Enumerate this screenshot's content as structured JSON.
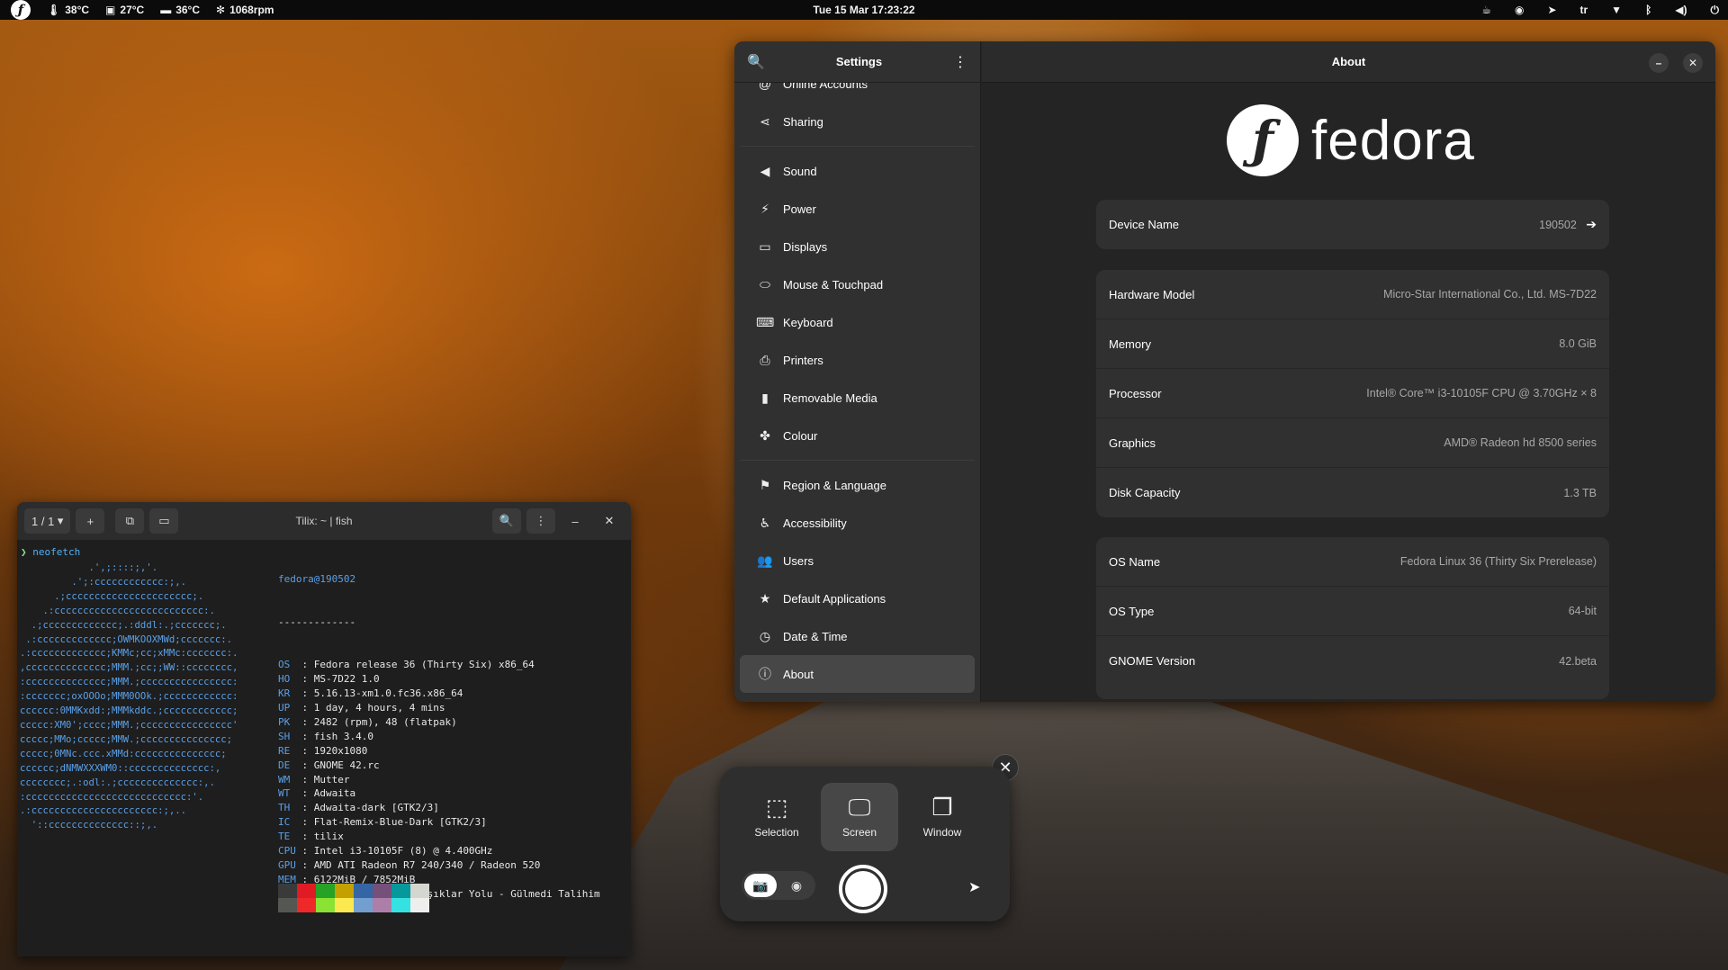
{
  "topbar": {
    "temp_cpu": "38°C",
    "temp_mb": "27°C",
    "temp_disk": "36°C",
    "fan": "1068rpm",
    "datetime": "Tue 15 Mar  17:23:22",
    "keyboard_layout": "tr"
  },
  "settings": {
    "title": "Settings",
    "content_title": "About",
    "sidebar": [
      {
        "label": "Online Accounts",
        "icon": "at-icon"
      },
      {
        "label": "Sharing",
        "icon": "share-icon"
      },
      {
        "label": "Sound",
        "icon": "speaker-icon"
      },
      {
        "label": "Power",
        "icon": "power-icon"
      },
      {
        "label": "Displays",
        "icon": "display-icon"
      },
      {
        "label": "Mouse & Touchpad",
        "icon": "mouse-icon"
      },
      {
        "label": "Keyboard",
        "icon": "keyboard-icon"
      },
      {
        "label": "Printers",
        "icon": "printer-icon"
      },
      {
        "label": "Removable Media",
        "icon": "usb-icon"
      },
      {
        "label": "Colour",
        "icon": "colour-icon"
      },
      {
        "label": "Region & Language",
        "icon": "flag-icon"
      },
      {
        "label": "Accessibility",
        "icon": "accessibility-icon"
      },
      {
        "label": "Users",
        "icon": "users-icon"
      },
      {
        "label": "Default Applications",
        "icon": "star-icon"
      },
      {
        "label": "Date & Time",
        "icon": "clock-icon"
      },
      {
        "label": "About",
        "icon": "info-icon"
      }
    ],
    "logo_text": "fedora",
    "device": {
      "label": "Device Name",
      "value": "190502"
    },
    "hardware": [
      {
        "label": "Hardware Model",
        "value": "Micro-Star International Co., Ltd. MS-7D22"
      },
      {
        "label": "Memory",
        "value": "8.0 GiB"
      },
      {
        "label": "Processor",
        "value": "Intel® Core™ i3-10105F CPU @ 3.70GHz × 8"
      },
      {
        "label": "Graphics",
        "value": "AMD® Radeon hd 8500 series"
      },
      {
        "label": "Disk Capacity",
        "value": "1.3 TB"
      }
    ],
    "os": [
      {
        "label": "OS Name",
        "value": "Fedora Linux 36 (Thirty Six Prerelease)"
      },
      {
        "label": "OS Type",
        "value": "64-bit"
      },
      {
        "label": "GNOME Version",
        "value": "42.beta"
      }
    ]
  },
  "terminal": {
    "tab_count": "1 / 1",
    "title": "Tilix: ~ | fish",
    "command": "neofetch",
    "user_host": "fedora@190502",
    "separator": "-------------",
    "info": [
      {
        "k": "OS",
        "v": "Fedora release 36 (Thirty Six) x86_64"
      },
      {
        "k": "HO",
        "v": "MS-7D22 1.0"
      },
      {
        "k": "KR",
        "v": "5.16.13-xm1.0.fc36.x86_64"
      },
      {
        "k": "UP",
        "v": "1 day, 4 hours, 4 mins"
      },
      {
        "k": "PK",
        "v": "2482 (rpm), 48 (flatpak)"
      },
      {
        "k": "SH",
        "v": "fish 3.4.0"
      },
      {
        "k": "RE",
        "v": "1920x1080"
      },
      {
        "k": "DE",
        "v": "GNOME 42.rc"
      },
      {
        "k": "WM",
        "v": "Mutter"
      },
      {
        "k": "WT",
        "v": "Adwaita"
      },
      {
        "k": "TH",
        "v": "Adwaita-dark [GTK2/3]"
      },
      {
        "k": "IC",
        "v": "Flat-Remix-Blue-Dark [GTK2/3]"
      },
      {
        "k": "TE",
        "v": "tilix"
      },
      {
        "k": "CPU",
        "v": "Intel i3-10105F (8) @ 4.400GHz"
      },
      {
        "k": "GPU",
        "v": "AMD ATI Radeon R7 240/340 / Radeon 520"
      },
      {
        "k": "MEM",
        "v": "6122MiB / 7852MiB"
      },
      {
        "k": "SNG",
        "v": "Murat Göğebakan - Aşıklar Yolu - Gülmedi Talihim"
      }
    ],
    "palette_top": [
      "#3a3a3a",
      "#e01b24",
      "#26a226",
      "#c4a000",
      "#3465a4",
      "#75507b",
      "#06989a",
      "#d3d7cf"
    ],
    "palette_bottom": [
      "#555753",
      "#ef2929",
      "#8ae234",
      "#fce94f",
      "#729fcf",
      "#ad7fa8",
      "#34e2e2",
      "#eeeeec"
    ],
    "bottom_prompt": "~"
  },
  "screenshot": {
    "modes": [
      {
        "label": "Selection",
        "icon": "selection-icon"
      },
      {
        "label": "Screen",
        "icon": "screen-icon"
      },
      {
        "label": "Window",
        "icon": "window-icon"
      }
    ]
  }
}
